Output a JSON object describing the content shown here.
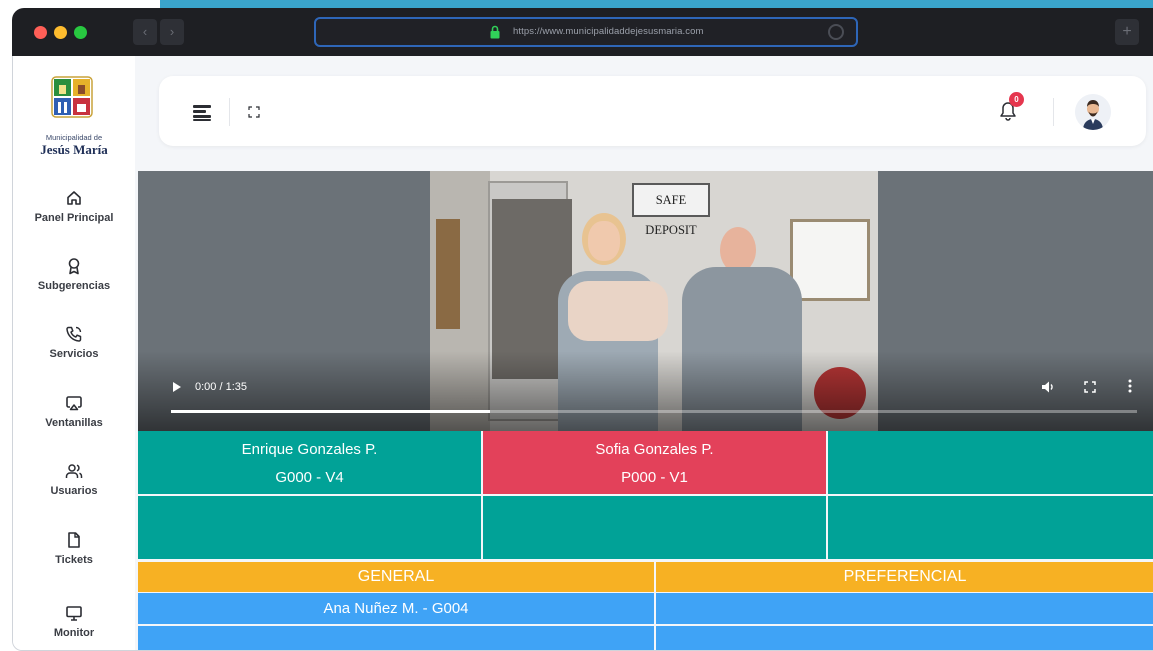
{
  "browser": {
    "url": "https://www.municipalidaddejesusmaria.com",
    "back_glyph": "‹",
    "forward_glyph": "›",
    "new_tab_glyph": "+",
    "icons": [
      "lock-icon",
      "reload-icon"
    ],
    "traffic_light_colors": [
      "#ff5f57",
      "#febc2e",
      "#28c840"
    ]
  },
  "brand": {
    "subtitle": "Municipalidad de",
    "name": "Jesús María",
    "logo_icon": "municipal-crest-icon"
  },
  "sidebar": {
    "items": [
      {
        "label": "Panel Principal",
        "icon": "home-icon"
      },
      {
        "label": "Subgerencias",
        "icon": "award-icon"
      },
      {
        "label": "Servicios",
        "icon": "phone-icon"
      },
      {
        "label": "Ventanillas",
        "icon": "cast-icon"
      },
      {
        "label": "Usuarios",
        "icon": "users-icon"
      },
      {
        "label": "Tickets",
        "icon": "file-icon"
      },
      {
        "label": "Monitor",
        "icon": "monitor-icon"
      }
    ]
  },
  "header": {
    "notification_count": "0",
    "icons": [
      "menu-icon",
      "fullscreen-icon",
      "bell-icon",
      "user-avatar"
    ]
  },
  "video": {
    "time": "0:00 / 1:35",
    "progress": 0.33,
    "scene_sign": "SAFE DEPOSIT",
    "icons": [
      "play-icon",
      "volume-icon",
      "fullscreen-icon",
      "more-vertical-icon"
    ]
  },
  "windows": {
    "rows": [
      [
        {
          "name": "Enrique Gonzales P.",
          "code": "G000 - V4",
          "color": "#01a297"
        },
        {
          "name": "Sofia Gonzales P.",
          "code": "P000 - V1",
          "color": "#e3415a"
        },
        {
          "name": "",
          "code": "",
          "color": "#01a297"
        }
      ],
      [
        {
          "name": "",
          "code": "",
          "color": "#01a297"
        },
        {
          "name": "",
          "code": "",
          "color": "#01a297"
        },
        {
          "name": "",
          "code": "",
          "color": "#01a297"
        }
      ]
    ]
  },
  "queues": {
    "general": {
      "title": "GENERAL",
      "entries": [
        "Ana Nuñez M. - G004",
        ""
      ]
    },
    "preferencial": {
      "title": "PREFERENCIAL",
      "entries": [
        "",
        ""
      ]
    },
    "colors": {
      "header": "#f7b123",
      "row": "#3fa3f6"
    }
  }
}
